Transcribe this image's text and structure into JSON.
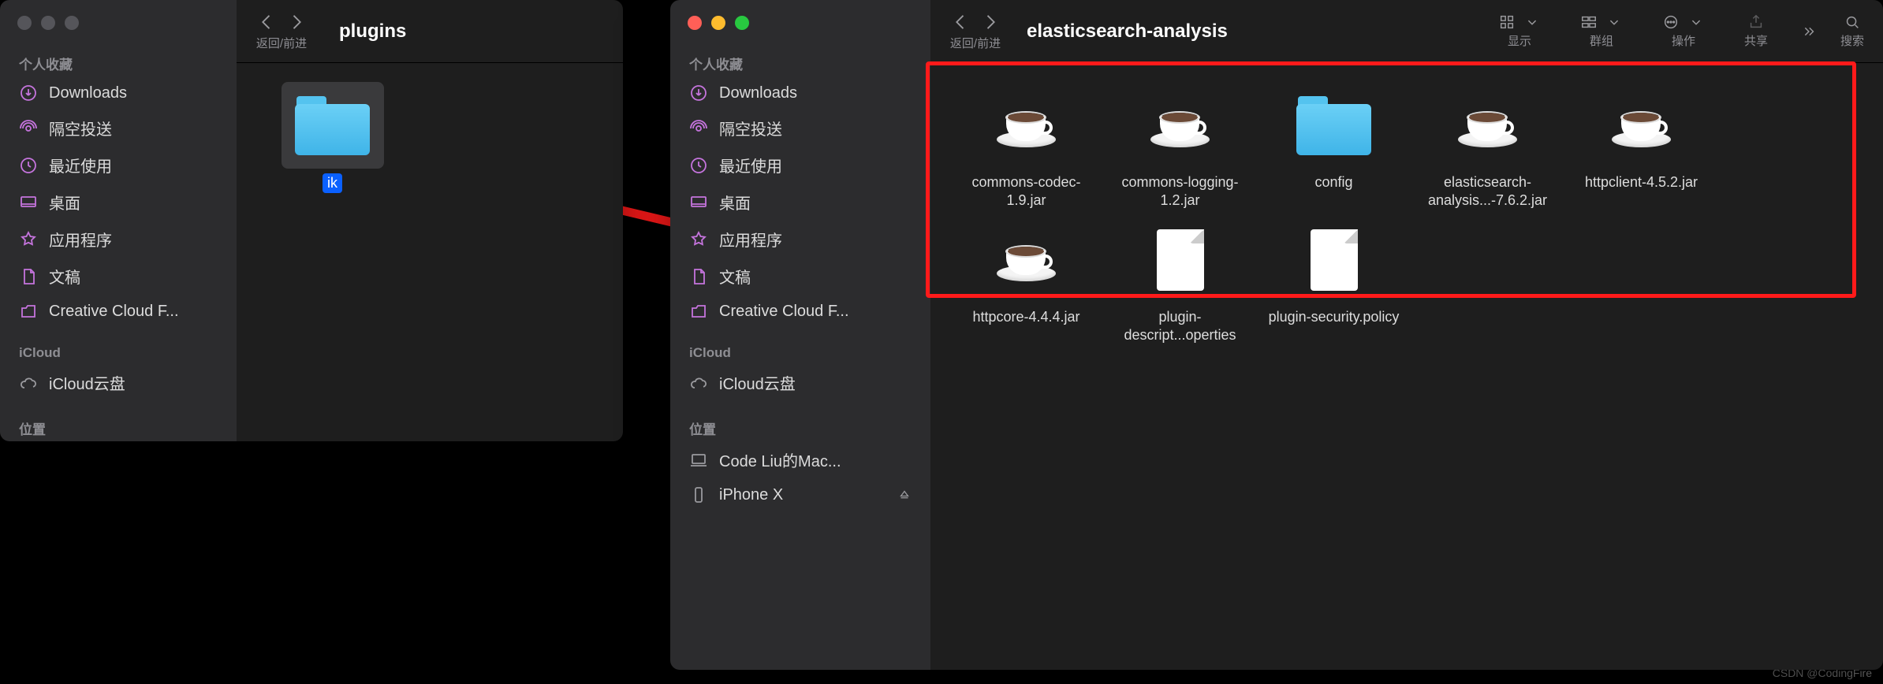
{
  "watermark": "CSDN @CodingFire",
  "sidebar_sections": {
    "favorites_header": "个人收藏",
    "icloud_header": "iCloud",
    "locations_header": "位置",
    "items": {
      "downloads": "Downloads",
      "airdrop": "隔空投送",
      "recents": "最近使用",
      "desktop": "桌面",
      "applications": "应用程序",
      "documents": "文稿",
      "creative_cloud": "Creative Cloud F...",
      "icloud_drive": "iCloud云盘",
      "mac": "Code Liu的Mac...",
      "iphone": "iPhone X"
    }
  },
  "window1": {
    "title": "plugins",
    "nav_label": "返回/前进",
    "files": [
      {
        "type": "folder",
        "label": "ik",
        "selected": true
      }
    ]
  },
  "window2": {
    "title": "elasticsearch-analysis",
    "nav_label": "返回/前进",
    "toolbar_labels": {
      "view": "显示",
      "group": "群组",
      "action": "操作",
      "share": "共享",
      "search": "搜索"
    },
    "files": [
      {
        "type": "java",
        "label": "commons-codec-1.9.jar"
      },
      {
        "type": "java",
        "label": "commons-logging-1.2.jar"
      },
      {
        "type": "folder",
        "label": "config"
      },
      {
        "type": "java",
        "label": "elasticsearch-analysis...-7.6.2.jar"
      },
      {
        "type": "java",
        "label": "httpclient-4.5.2.jar"
      },
      {
        "type": "java",
        "label": "httpcore-4.4.4.jar"
      },
      {
        "type": "doc",
        "label": "plugin-descript...operties"
      },
      {
        "type": "doc",
        "label": "plugin-security.policy"
      }
    ]
  }
}
